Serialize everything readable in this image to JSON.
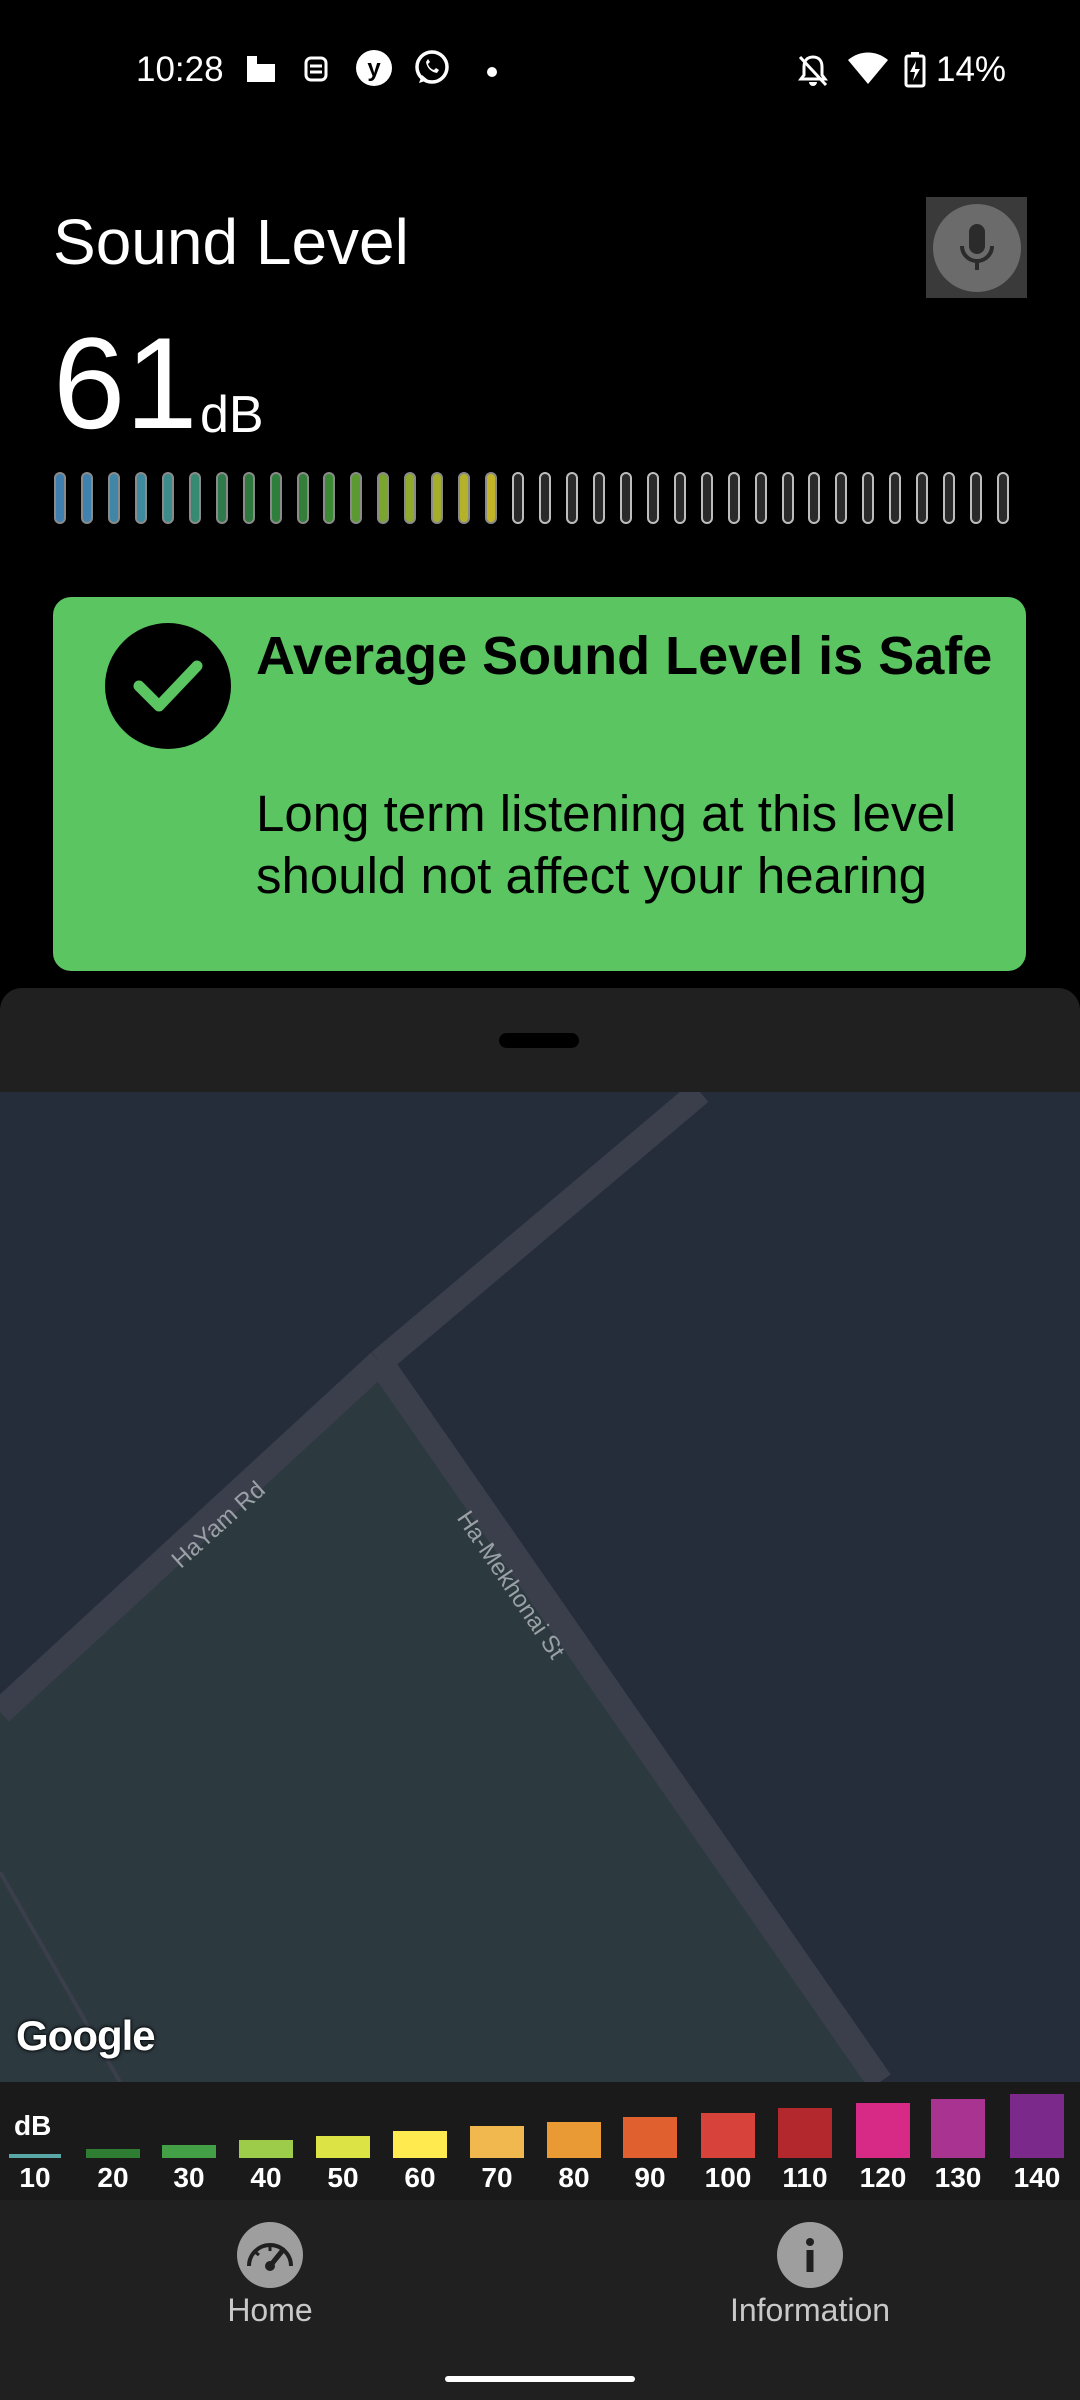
{
  "status_bar": {
    "time": "10:28",
    "battery": "14%",
    "icons": [
      "media-icon",
      "robot-icon",
      "yahoo-icon",
      "whatsapp-icon",
      "dot-icon",
      "bell-off-icon",
      "wifi-icon",
      "battery-charging-icon"
    ]
  },
  "header": {
    "title": "Sound Level",
    "mic_icon": "microphone-icon"
  },
  "reading": {
    "value": "61",
    "unit": "dB",
    "meter_bars_total": 36,
    "meter_bars_lit": 17
  },
  "status_card": {
    "title": "Average Sound Level is Safe",
    "description": "Long term listening at this level should not affect your hearing",
    "color": "#5bc562",
    "icon": "check-icon"
  },
  "map": {
    "roads": [
      "HaYam Rd",
      "Ha-Mekhonai St"
    ],
    "attribution": "Google"
  },
  "legend": {
    "unit_label": "dB",
    "items": [
      {
        "label": "10",
        "color": "#5aa7a8"
      },
      {
        "label": "20",
        "color": "#2e7d32"
      },
      {
        "label": "30",
        "color": "#43a047"
      },
      {
        "label": "40",
        "color": "#9ccc4a"
      },
      {
        "label": "50",
        "color": "#dce445"
      },
      {
        "label": "60",
        "color": "#ffeb4f"
      },
      {
        "label": "70",
        "color": "#f0b84f"
      },
      {
        "label": "80",
        "color": "#e99a35"
      },
      {
        "label": "90",
        "color": "#e0602f"
      },
      {
        "label": "100",
        "color": "#d7433a"
      },
      {
        "label": "110",
        "color": "#b3282c"
      },
      {
        "label": "120",
        "color": "#d62a86"
      },
      {
        "label": "130",
        "color": "#a93390"
      },
      {
        "label": "140",
        "color": "#7b2a8c"
      }
    ]
  },
  "nav": {
    "home": "Home",
    "information": "Information"
  }
}
